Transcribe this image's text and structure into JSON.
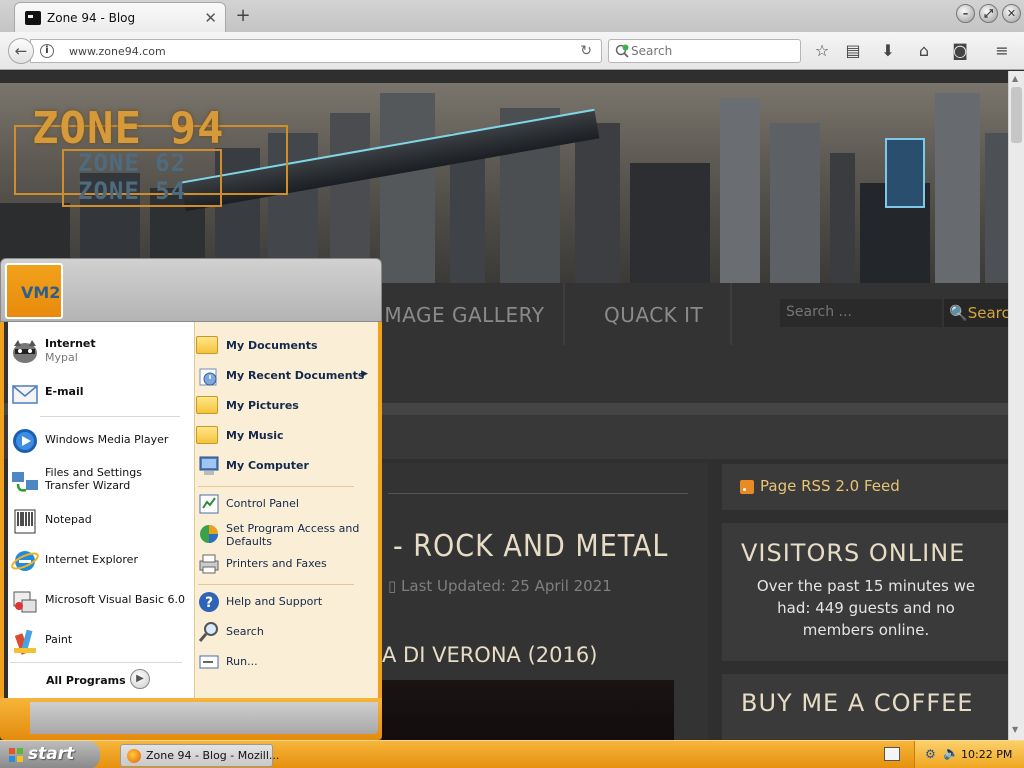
{
  "browser": {
    "tab_title": "Zone 94 - Blog",
    "tab_close": "✕",
    "new_tab": "+",
    "url": "www.zone94.com",
    "search_placeholder": "Search",
    "icons": [
      "back-icon",
      "site-info-icon",
      "reload-icon",
      "bookmark-star-icon",
      "reading-list-icon",
      "download-icon",
      "home-icon",
      "pocket-icon",
      "menu-icon"
    ]
  },
  "site": {
    "logo": {
      "main": "ZONE 94",
      "sub1": "ZONE 62",
      "sub2": "ZONE 54"
    },
    "nav": [
      "IMAGE GALLERY",
      "QUACK IT"
    ],
    "search_placeholder": "Search ...",
    "search_button": "Search",
    "article": {
      "title": "- ROCK AND METAL",
      "meta": "Last Updated: 25 April 2021",
      "subtitle": "A DI VERONA (2016)"
    },
    "sidebar": {
      "rss": "Page RSS 2.0 Feed",
      "visitors_title": "VISITORS ONLINE",
      "visitors_text": "Over the past 15 minutes we had: 449 guests and no members online.",
      "coffee_title": "BUY ME A COFFEE"
    }
  },
  "startmenu": {
    "user": "VM2",
    "left": [
      {
        "label": "Internet",
        "sub": "Mypal",
        "bold": true,
        "icon": "raccoon-icon"
      },
      {
        "label": "E-mail",
        "bold": true,
        "icon": "email-icon"
      },
      {
        "label": "Windows Media Player",
        "icon": "media-player-icon"
      },
      {
        "label": "Files and Settings Transfer Wizard",
        "icon": "transfer-wizard-icon"
      },
      {
        "label": "Notepad",
        "icon": "notepad-icon"
      },
      {
        "label": "Internet Explorer",
        "icon": "internet-explorer-icon"
      },
      {
        "label": "Microsoft Visual Basic 6.0",
        "icon": "visual-basic-icon"
      },
      {
        "label": "Paint",
        "icon": "paint-icon"
      }
    ],
    "all_programs": "All Programs",
    "right": [
      {
        "label": "My Documents",
        "bold": true,
        "icon": "folder-documents-icon"
      },
      {
        "label": "My Recent Documents",
        "bold": true,
        "icon": "recent-documents-icon"
      },
      {
        "label": "My Pictures",
        "bold": true,
        "icon": "folder-pictures-icon"
      },
      {
        "label": "My Music",
        "bold": true,
        "icon": "folder-music-icon"
      },
      {
        "label": "My Computer",
        "bold": true,
        "icon": "computer-icon"
      },
      {
        "label": "Control Panel",
        "icon": "control-panel-icon"
      },
      {
        "label": "Set Program Access and Defaults",
        "icon": "program-access-icon"
      },
      {
        "label": "Printers and Faxes",
        "icon": "printer-icon"
      },
      {
        "label": "Help and Support",
        "icon": "help-icon"
      },
      {
        "label": "Search",
        "icon": "search-icon"
      },
      {
        "label": "Run...",
        "icon": "run-icon"
      }
    ]
  },
  "taskbar": {
    "start": "start",
    "task": "Zone 94 - Blog - Mozill...",
    "clock": "10:22 PM"
  }
}
